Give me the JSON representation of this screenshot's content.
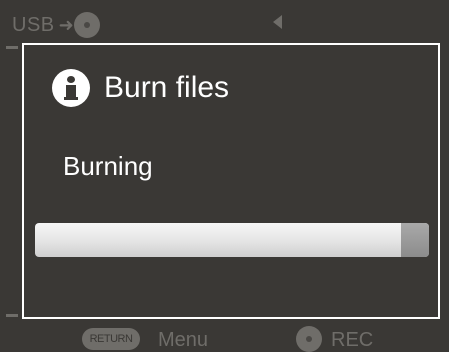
{
  "status_bar": {
    "usb_label": "USB",
    "usb_icon": "usb-plug-icon",
    "nav_icon": "triangle-left-icon"
  },
  "dialog": {
    "icon": "info-icon",
    "title": "Burn files",
    "status": "Burning",
    "progress_fraction": 0.93
  },
  "footer": {
    "return_label": "RETURN",
    "menu_label": "Menu",
    "rec_label": "REC"
  },
  "colors": {
    "background": "#3a3835",
    "dim_text": "#6f6d69",
    "foreground": "#ffffff"
  }
}
